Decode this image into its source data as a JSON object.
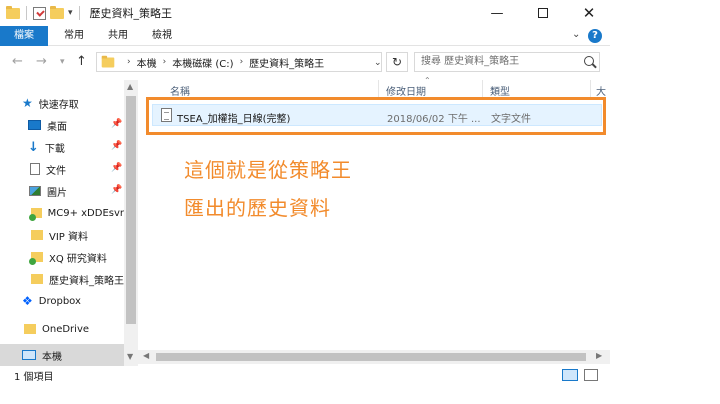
{
  "window": {
    "title": "歷史資料_策略王"
  },
  "ribbon": {
    "tabs": [
      "檔案",
      "常用",
      "共用",
      "檢視"
    ],
    "help": "?"
  },
  "address": {
    "crumbs": [
      "本機",
      "本機磁碟 (C:)",
      "歷史資料_策略王"
    ],
    "search_placeholder": "搜尋 歷史資料_策略王"
  },
  "sidebar": {
    "quick_access": "快速存取",
    "items": [
      {
        "label": "桌面",
        "icon": "desktop-icon"
      },
      {
        "label": "下載",
        "icon": "download-icon"
      },
      {
        "label": "文件",
        "icon": "documents-icon"
      },
      {
        "label": "圖片",
        "icon": "pictures-icon"
      },
      {
        "label": "MC9+ xDDEsvr",
        "icon": "folder-icon"
      },
      {
        "label": "VIP 資料",
        "icon": "folder-icon"
      },
      {
        "label": "XQ 研究資料",
        "icon": "folder-icon"
      },
      {
        "label": "歷史資料_策略王",
        "icon": "folder-icon"
      },
      {
        "label": "Dropbox",
        "icon": "dropbox-icon"
      },
      {
        "label": "OneDrive",
        "icon": "onedrive-icon"
      },
      {
        "label": "本機",
        "icon": "this-pc-icon"
      }
    ]
  },
  "list": {
    "headers": [
      "名稱",
      "修改日期",
      "類型",
      "大"
    ],
    "rows": [
      {
        "name": "TSEA_加權指_日線(完整)",
        "modified": "2018/06/02 下午 ...",
        "type": "文字文件"
      }
    ]
  },
  "annotation": {
    "line1": "這個就是從策略王",
    "line2": "匯出的歷史資料",
    "color": "#f28b2c"
  },
  "status": {
    "count": "1 個項目"
  }
}
